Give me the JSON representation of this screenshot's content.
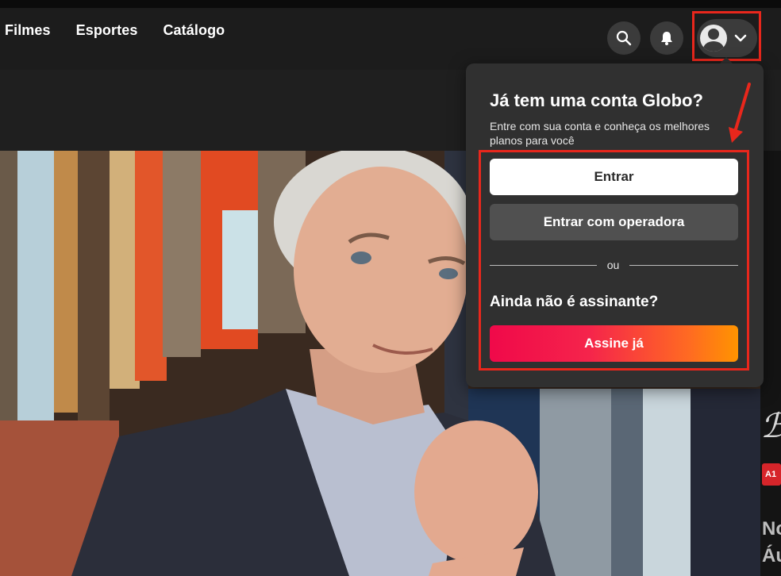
{
  "nav": {
    "items": [
      "Filmes",
      "Esportes",
      "Catálogo"
    ]
  },
  "header_icons": {
    "search": "search-icon",
    "notifications": "bell-icon",
    "profile": "user-avatar-icon",
    "profile_chevron": "chevron-down-icon"
  },
  "login_menu": {
    "title": "Já tem uma conta Globo?",
    "subtitle": "Entre com sua conta e conheça os melhores planos para você",
    "signin_label": "Entrar",
    "operator_signin_label": "Entrar com operadora",
    "separator": "ou",
    "subscribe_prompt": "Ainda não é assinante?",
    "subscribe_label": "Assine já"
  },
  "colors": {
    "annotation_red": "#e8271c",
    "subscribe_gradient_start": "#f0094a",
    "subscribe_gradient_end": "#ff9400",
    "menu_background": "#303030"
  }
}
